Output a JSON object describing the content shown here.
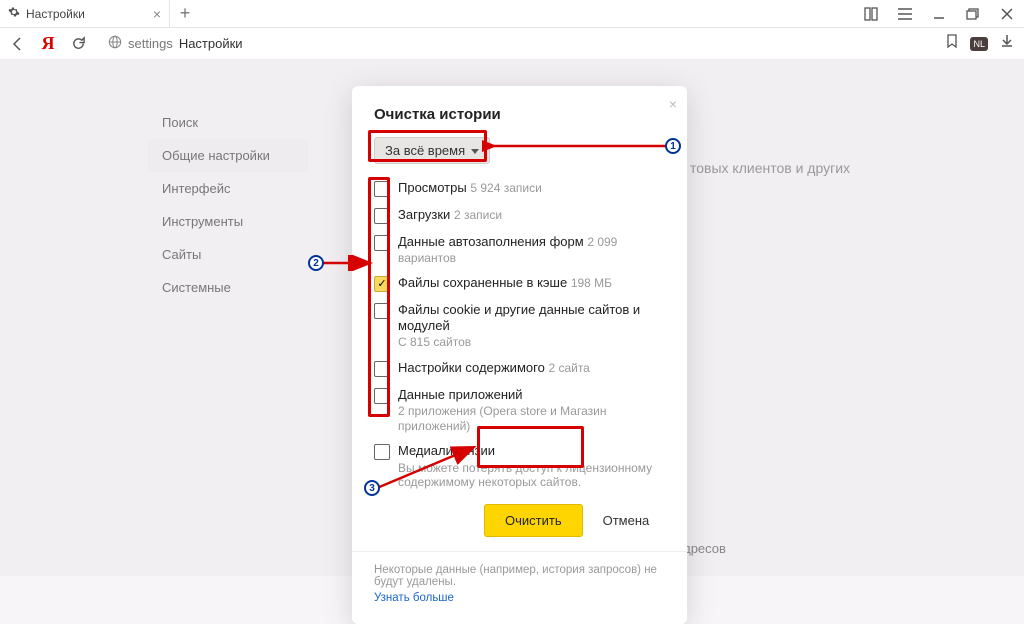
{
  "window": {
    "tab_title": "Настройки"
  },
  "address": {
    "host": "settings",
    "path": "Настройки"
  },
  "sidebar": {
    "items": [
      {
        "label": "Поиск"
      },
      {
        "label": "Общие настройки"
      },
      {
        "label": "Интерфейс"
      },
      {
        "label": "Инструменты"
      },
      {
        "label": "Сайты"
      },
      {
        "label": "Системные"
      }
    ]
  },
  "bg": {
    "text1": "товых клиентов и других",
    "check_label": "Показывать подсказки при наборе запросов и адресов"
  },
  "ext": {
    "badge": "NL"
  },
  "modal": {
    "title": "Очистка истории",
    "range": "За всё время",
    "items": [
      {
        "label": "Просмотры",
        "hint": "5 924 записи",
        "checked": false
      },
      {
        "label": "Загрузки",
        "hint": "2 записи",
        "checked": false
      },
      {
        "label": "Данные автозаполнения форм",
        "hint": "2 099 вариантов",
        "checked": false
      },
      {
        "label": "Файлы сохраненные в кэше",
        "hint": "198 МБ",
        "checked": true
      },
      {
        "label": "Файлы cookie и другие данные сайтов и модулей",
        "sub": "С 815 сайтов",
        "checked": false
      },
      {
        "label": "Настройки содержимого",
        "hint": "2 сайта",
        "checked": false
      },
      {
        "label": "Данные приложений",
        "sub": "2 приложения (Opera store и Магазин приложений)",
        "checked": false
      },
      {
        "label": "Медиалицензии",
        "sub": "Вы можете потерять доступ к лицензионному содержимому некоторых сайтов.",
        "checked": false
      }
    ],
    "clear": "Очистить",
    "cancel": "Отмена",
    "disclaimer": "Некоторые данные (например, история запросов) не будут удалены.",
    "more": "Узнать больше"
  },
  "anno": {
    "n1": "1",
    "n2": "2",
    "n3": "3"
  }
}
